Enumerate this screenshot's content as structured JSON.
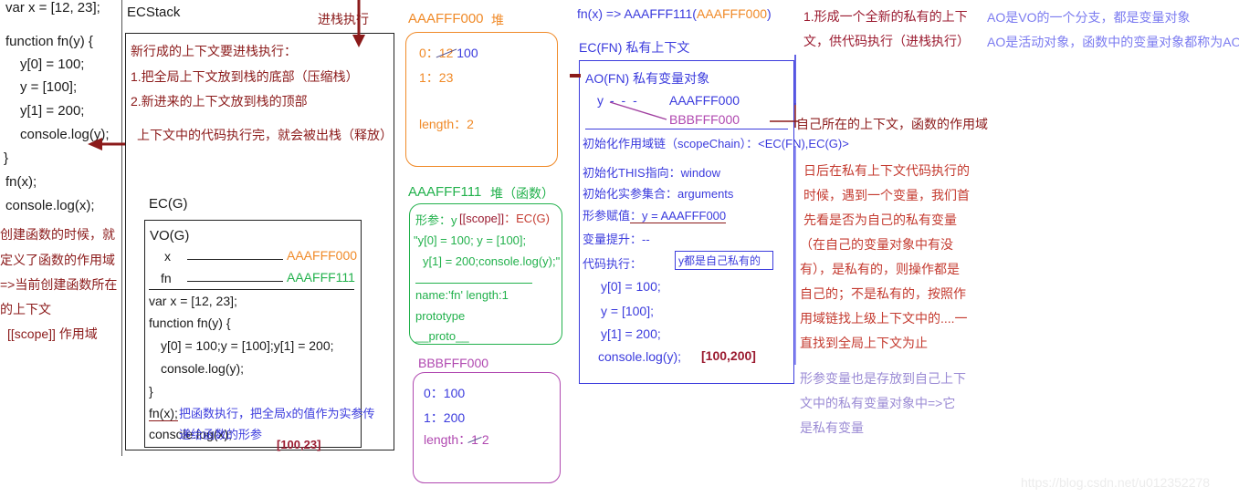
{
  "left_code": {
    "lines": [
      "var x = [12, 23];",
      "function fn(y) {",
      "y[0] = 100;",
      "y = [100];",
      "y[1] = 200;",
      "console.log(y);",
      "}",
      "fn(x);",
      "console.log(x);"
    ],
    "notes": [
      "创建函数的时候，就",
      "定义了函数的作用域",
      "=>当前创建函数所在",
      "的上下文",
      "[[scope]] 作用域"
    ]
  },
  "ecstack": {
    "title": "ECStack",
    "push_label": "进栈执行",
    "rules": [
      "新行成的上下文要进栈执行：",
      "1.把全局上下文放到栈的底部（压缩栈）",
      "2.新进来的上下文放到栈的顶部"
    ],
    "pop_note": "上下文中的代码执行完，就会被出栈（释放）",
    "ecg_label": "EC(G)"
  },
  "vo_g": {
    "title": "VO(G)",
    "vars": [
      {
        "name": "x",
        "value": "AAAFFF000",
        "color": "orange"
      },
      {
        "name": "fn",
        "value": "AAAFFF111",
        "color": "green"
      }
    ],
    "code": [
      "var x = [12, 23];",
      "function fn(y) {",
      "y[0] = 100;y = [100];y[1] = 200;",
      "console.log(y);",
      "}",
      "fn(x);",
      "console.log(x);"
    ],
    "annotation": [
      "把函数执行，把全局x的值作为实参传",
      "递给函数的形参"
    ],
    "result": "[100,23]"
  },
  "heap_aaafff000": {
    "title": "AAAFFF000",
    "kind": "堆",
    "rows": [
      {
        "key": "0",
        "sep": "：",
        "old": "12",
        "new": "100"
      },
      {
        "key": "1",
        "sep": "：",
        "old": "23",
        "new": ""
      }
    ],
    "length": "length：2"
  },
  "heap_aaafff111": {
    "title": "AAAFFF111",
    "kind": "堆（函数）",
    "param_label": "形参：y",
    "scope_label": "[[scope]]",
    "scope_value": "：EC(G)",
    "body": [
      "\"y[0] = 100; y = [100];",
      "y[1] = 200;console.log(y);\""
    ],
    "meta": "name:'fn'   length:1",
    "prototype": "prototype",
    "proto": "__proto__"
  },
  "heap_bbbfff000": {
    "title": "BBBFFF000",
    "rows": [
      "0：100",
      "1：200"
    ],
    "length_label": "length：",
    "length_old": "1",
    "length_new": "2"
  },
  "ec_fn": {
    "call_line_a": "fn(x) => AAAFFF111(",
    "call_line_b": "AAAFFF000",
    "call_line_c": ")",
    "title": "EC(FN)  私有上下文",
    "ao_title": "AO(FN)  私有变量对象",
    "y_label": "y",
    "y_dashes": "-    -    -",
    "y_ref_old": "AAAFFF000",
    "y_ref_new": "BBBFFF000",
    "scope_chain": "初始化作用域链（scopeChain）：<EC(FN),EC(G)>",
    "this_line": "初始化THIS指向：window",
    "args_line": "初始化实参集合：arguments",
    "param_assign_label": "形参赋值",
    "param_assign_value": "：y = AAAFFF000",
    "hoist_line": "变量提升：--",
    "exec_label": "代码执行：",
    "exec_badge": "y都是自己私有的",
    "exec_code": [
      "y[0] = 100;",
      "y = [100];",
      "y[1] = 200;"
    ],
    "console_line": "console.log(y);",
    "console_result": "[100,200]"
  },
  "notes_right": {
    "new_ctx": [
      "1.形成一个全新的私有的上下",
      "文，供代码执行（进栈执行）"
    ],
    "scope_note": "自己所在的上下文，函数的作用域",
    "lookup": [
      "日后在私有上下文代码执行的",
      "时候，遇到一个变量，我们首",
      "先看是否为自己的私有变量",
      "（在自己的变量对象中有没",
      "有），是私有的，则操作都是",
      "自己的；不是私有的，按照作",
      "用域链找上级上下文中的....一",
      "直找到全局上下文为止"
    ],
    "param_note": [
      "形参变量也是存放到自己上下",
      "文中的私有变量对象中=>它",
      "是私有变量"
    ]
  },
  "notes_far_right": {
    "lines": [
      "AO是VO的一个分支，都是变量对象",
      "AO是活动对象，函数中的变量对象都称为AO"
    ]
  },
  "watermark": "https://blog.csdn.net/u012352278",
  "colors": {
    "dark_red": "#8b1a1a",
    "orange": "#f08a28",
    "green": "#22b14c",
    "purple": "#b048b0",
    "blue": "#3b3bdd",
    "red": "#c43a2f",
    "lavender": "#9a8ad4"
  }
}
